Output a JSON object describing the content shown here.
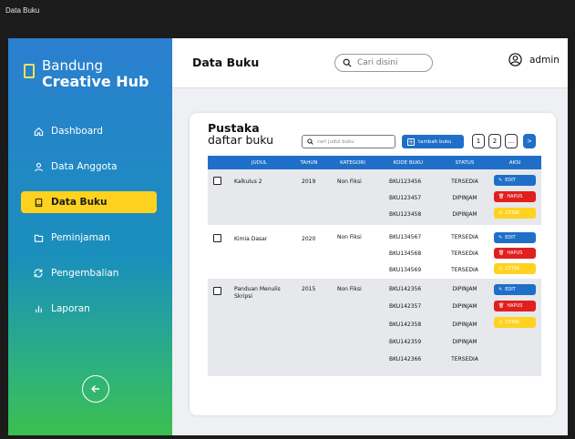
{
  "window": {
    "title": "Data Buku"
  },
  "brand": {
    "line1": "Bandung",
    "line2": "Creative Hub"
  },
  "nav": [
    {
      "label": "Dashboard",
      "icon": "home-icon"
    },
    {
      "label": "Data Anggota",
      "icon": "user-icon"
    },
    {
      "label": "Data Buku",
      "icon": "book-icon",
      "active": true
    },
    {
      "label": "Peminjaman",
      "icon": "folder-icon"
    },
    {
      "label": "Pengembalian",
      "icon": "refresh-icon"
    },
    {
      "label": "Laporan",
      "icon": "bar-chart-icon"
    }
  ],
  "header": {
    "title": "Data Buku",
    "search_placeholder": "Cari disini",
    "user": "admin"
  },
  "card": {
    "title_line1": "Pustaka",
    "title_line2": "daftar buku",
    "search_placeholder": "cari judul buku",
    "add_label": "tambah buku",
    "pages": [
      "1",
      "2",
      "..."
    ],
    "next": ">"
  },
  "table": {
    "columns": [
      "JUDUL",
      "TAHUN",
      "KATEGORI",
      "KODE BUKU",
      "STATUS",
      "AKSI"
    ],
    "actions": {
      "edit": "EDIT",
      "hapus": "HAPUS",
      "cetak": "CETAK"
    },
    "rows": [
      {
        "judul": "Kalkulus 2",
        "tahun": "2019",
        "kategori": "Non Fiksi",
        "copies": [
          {
            "kode": "BKU123456",
            "status": "TERSEDIA"
          },
          {
            "kode": "BKU123457",
            "status": "DIPINJAM"
          },
          {
            "kode": "BKU123458",
            "status": "DIPINJAM"
          }
        ]
      },
      {
        "judul": "Kimia Dasar",
        "tahun": "2020",
        "kategori": "Non Fiksi",
        "copies": [
          {
            "kode": "BKU134567",
            "status": "TERSEDIA"
          },
          {
            "kode": "BKU134568",
            "status": "TERSEDIA"
          },
          {
            "kode": "BKU134569",
            "status": "TERSEDIA"
          }
        ]
      },
      {
        "judul": "Panduan Menulis Skripsi",
        "tahun": "2015",
        "kategori": "Non Fiksi",
        "copies": [
          {
            "kode": "BKU142356",
            "status": "DIPINJAM"
          },
          {
            "kode": "BKU142357",
            "status": "DIPINJAM"
          },
          {
            "kode": "BKU142358",
            "status": "DIPINJAM"
          },
          {
            "kode": "BKU142359",
            "status": "DIPINJAM"
          },
          {
            "kode": "BKU142366",
            "status": "TERSEDIA"
          }
        ]
      }
    ]
  },
  "colors": {
    "primary": "#1f6fc9",
    "accent": "#ffd21f",
    "danger": "#e0201f"
  }
}
